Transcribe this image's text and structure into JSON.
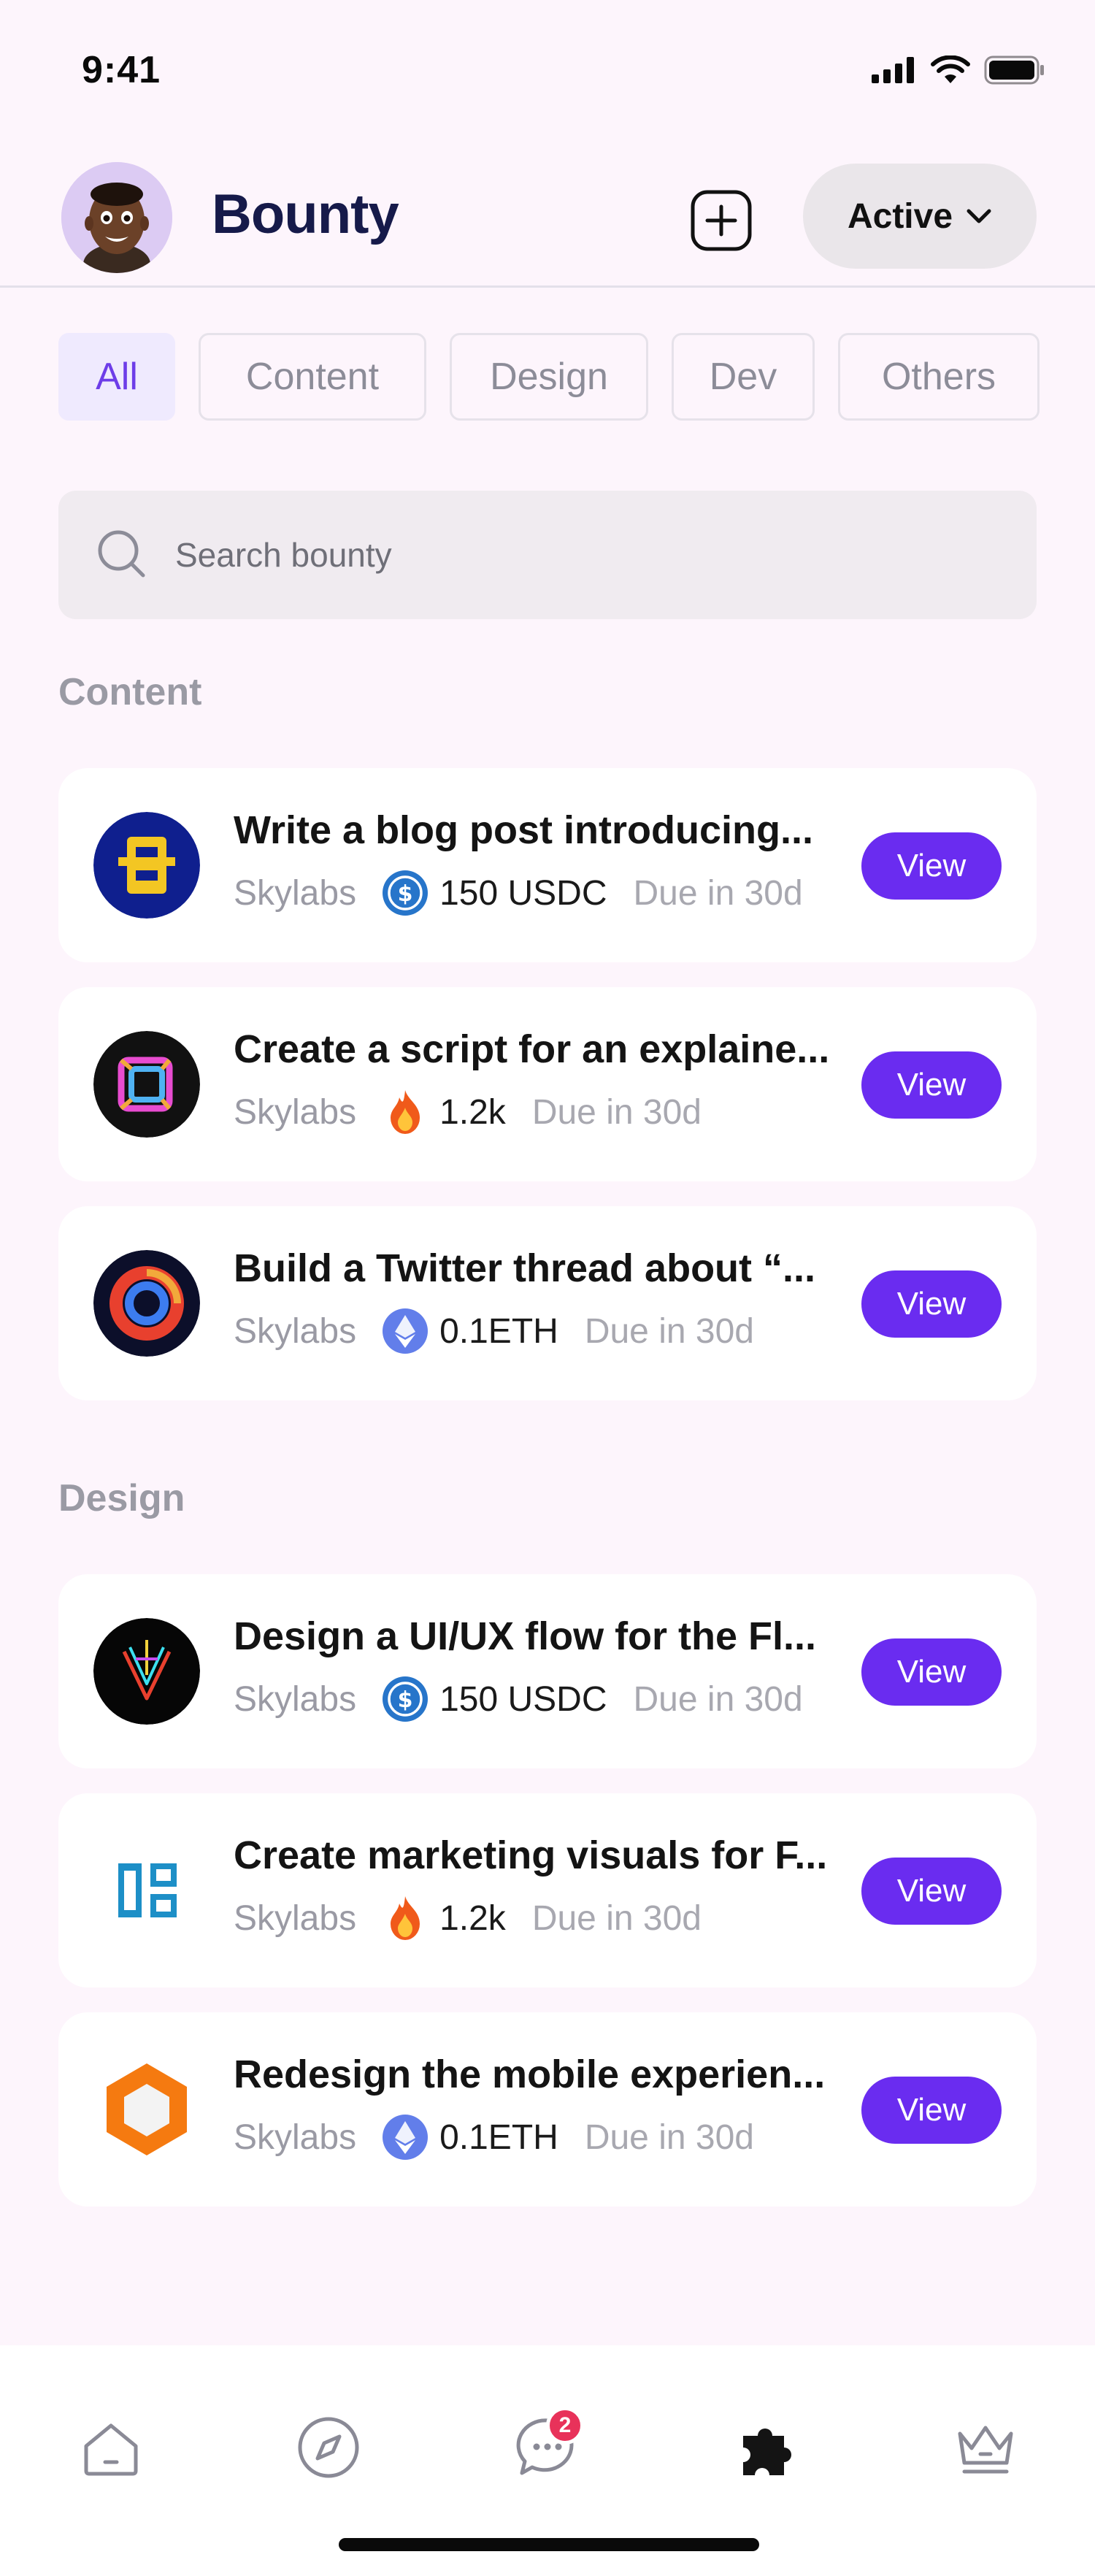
{
  "status_bar": {
    "time": "9:41"
  },
  "header": {
    "title": "Bounty",
    "status_filter": "Active"
  },
  "filters": [
    {
      "label": "All",
      "active": true
    },
    {
      "label": "Content",
      "active": false
    },
    {
      "label": "Design",
      "active": false
    },
    {
      "label": "Dev",
      "active": false
    },
    {
      "label": "Others",
      "active": false
    }
  ],
  "search": {
    "placeholder": "Search bounty"
  },
  "sections": [
    {
      "title": "Content",
      "items": [
        {
          "title": "Write a blog post introducing...",
          "org": "Skylabs",
          "reward_icon": "usdc-icon",
          "reward": "150 USDC",
          "due": "Due in 30d",
          "action": "View"
        },
        {
          "title": "Create a script for an explaine...",
          "org": "Skylabs",
          "reward_icon": "fire-icon",
          "reward": "1.2k",
          "due": "Due in 30d",
          "action": "View"
        },
        {
          "title": "Build a Twitter thread about “...",
          "org": "Skylabs",
          "reward_icon": "eth-icon",
          "reward": "0.1ETH",
          "due": "Due in 30d",
          "action": "View"
        }
      ]
    },
    {
      "title": "Design",
      "items": [
        {
          "title": "Design a UI/UX flow for the Fl...",
          "org": "Skylabs",
          "reward_icon": "usdc-icon",
          "reward": "150 USDC",
          "due": "Due in 30d",
          "action": "View"
        },
        {
          "title": "Create marketing visuals for F...",
          "org": "Skylabs",
          "reward_icon": "fire-icon",
          "reward": "1.2k",
          "due": "Due in 30d",
          "action": "View"
        },
        {
          "title": "Redesign the mobile experien...",
          "org": "Skylabs",
          "reward_icon": "eth-icon",
          "reward": "0.1ETH",
          "due": "Due in 30d",
          "action": "View"
        }
      ]
    }
  ],
  "bottom_nav": {
    "items": [
      {
        "icon": "home-icon",
        "active": false
      },
      {
        "icon": "compass-icon",
        "active": false
      },
      {
        "icon": "chat-icon",
        "active": false,
        "badge": "2"
      },
      {
        "icon": "puzzle-icon",
        "active": true
      },
      {
        "icon": "crown-icon",
        "active": false
      }
    ]
  },
  "colors": {
    "accent": "#6a2cf0",
    "background": "#fdf5fc",
    "badge": "#e8325a"
  }
}
